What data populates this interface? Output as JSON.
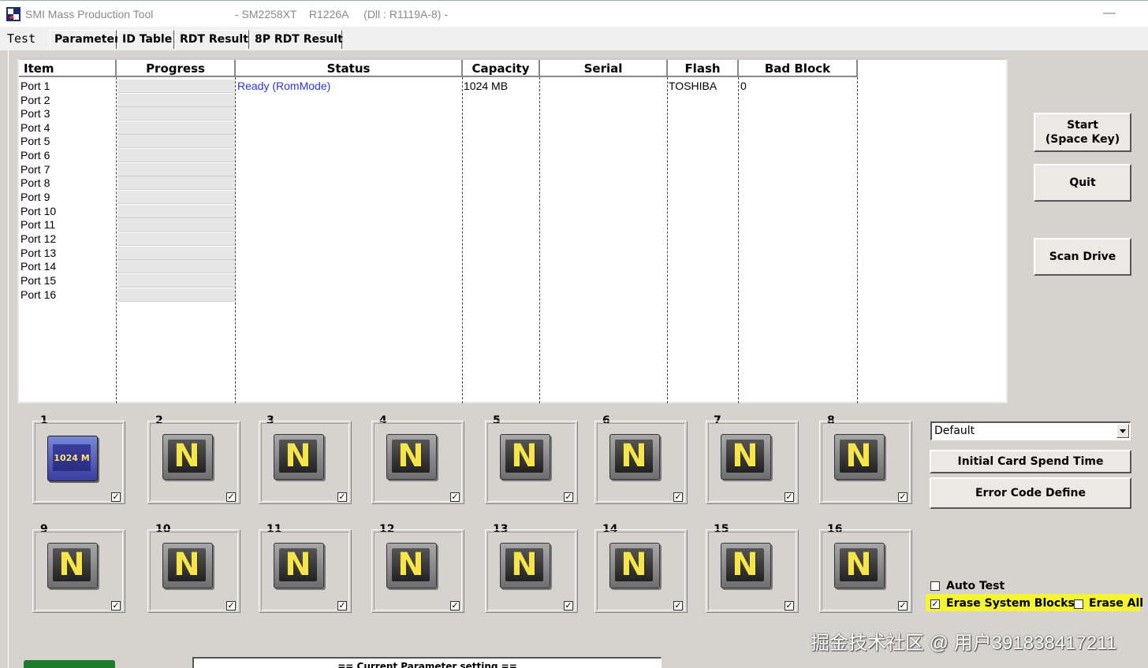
{
  "window": {
    "title": "SMI Mass Production Tool",
    "title_extra": "- SM2258XT    R1226A     (Dll : R1119A-8) -",
    "minimize_glyph": "—"
  },
  "tabs": [
    {
      "label": "Test",
      "active": true
    },
    {
      "label": "Parameter",
      "active": false
    },
    {
      "label": "ID Table",
      "active": false
    },
    {
      "label": "RDT Result",
      "active": false
    },
    {
      "label": "8P RDT Result",
      "active": false
    }
  ],
  "grid": {
    "columns": [
      "Item",
      "Progress",
      "Status",
      "Capacity",
      "Serial",
      "Flash",
      "Bad Block"
    ],
    "ports": [
      "Port 1",
      "Port 2",
      "Port 3",
      "Port 4",
      "Port 5",
      "Port 6",
      "Port 7",
      "Port 8",
      "Port 9",
      "Port 10",
      "Port 11",
      "Port 12",
      "Port 13",
      "Port 14",
      "Port 15",
      "Port 16"
    ],
    "row1": {
      "status": "Ready (RomMode)",
      "capacity": "1024 MB",
      "serial": "",
      "flash": "TOSHIBA",
      "bad_block": "0"
    }
  },
  "buttons": {
    "start_line1": "Start",
    "start_line2": "(Space Key)",
    "quit": "Quit",
    "scan_drive": "Scan Drive",
    "initial_card_spend_time": "Initial Card Spend Time",
    "error_code_define": "Error Code Define"
  },
  "slots": [
    {
      "num": "1",
      "state": "card",
      "label": "1024 M",
      "checked": true
    },
    {
      "num": "2",
      "state": "N",
      "checked": true
    },
    {
      "num": "3",
      "state": "N",
      "checked": true
    },
    {
      "num": "4",
      "state": "N",
      "checked": true
    },
    {
      "num": "5",
      "state": "N",
      "checked": true
    },
    {
      "num": "6",
      "state": "N",
      "checked": true
    },
    {
      "num": "7",
      "state": "N",
      "checked": true
    },
    {
      "num": "8",
      "state": "N",
      "checked": true
    },
    {
      "num": "9",
      "state": "N",
      "checked": true
    },
    {
      "num": "10",
      "state": "N",
      "checked": true
    },
    {
      "num": "11",
      "state": "N",
      "checked": true
    },
    {
      "num": "12",
      "state": "N",
      "checked": true
    },
    {
      "num": "13",
      "state": "N",
      "checked": true
    },
    {
      "num": "14",
      "state": "N",
      "checked": true
    },
    {
      "num": "15",
      "state": "N",
      "checked": true
    },
    {
      "num": "16",
      "state": "N",
      "checked": true
    }
  ],
  "slot_letter": "N",
  "check_glyph": "✓",
  "profile_select": {
    "value": "Default"
  },
  "options": {
    "auto_test": {
      "label": "Auto Test",
      "checked": false
    },
    "erase_system_blocks": {
      "label": "Erase System Blocks",
      "checked": true
    },
    "erase_all": {
      "label": "Erase All",
      "checked": false
    }
  },
  "parameter_box_title": "== Current Parameter setting ==",
  "watermark": "掘金技术社区 @ 用户391838417211",
  "colors": {
    "status_blue": "#2a35d8",
    "highlight": "#ffff00",
    "n_letter": "#f5e54a"
  }
}
